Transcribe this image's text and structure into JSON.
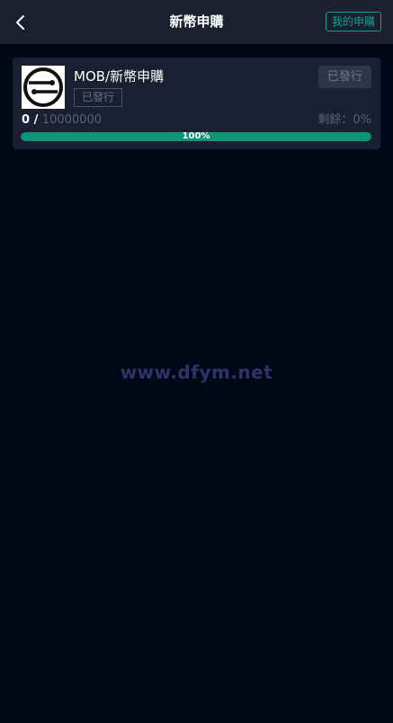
{
  "header": {
    "back_icon": "chevron-left-icon",
    "title": "新幣申購",
    "my_subscription_label": "我的申購"
  },
  "subscription": {
    "logo_icon": "mob-token-logo-icon",
    "name": "MOB/新幣申購",
    "status_tag": "已發行",
    "action_label": "已發行",
    "sold": "0",
    "separator": " / ",
    "total": "10000000",
    "remaining_label": "剩餘：0%",
    "progress_fraction": 1.0,
    "progress_text": "100%"
  },
  "watermark": "www.dfym.net",
  "colors": {
    "background": "#020818",
    "header_bg": "#1b1f30",
    "card_bg": "#1a1f32",
    "accent": "#17a087",
    "progress_fill": "#0e9477",
    "muted_text": "#5b6178"
  }
}
